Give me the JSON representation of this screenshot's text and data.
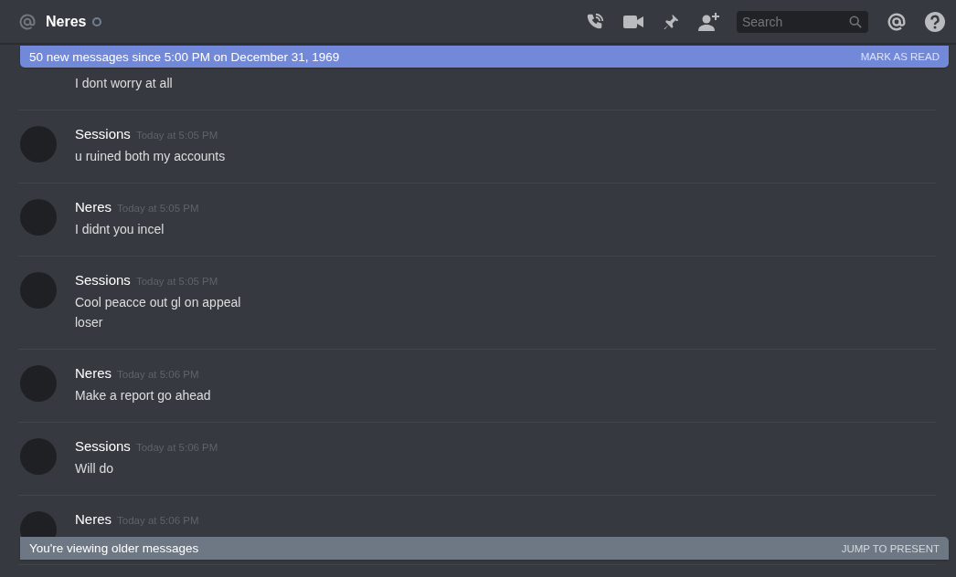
{
  "header": {
    "title": "Neres",
    "search_placeholder": "Search"
  },
  "new_messages_bar": {
    "text": "50 new messages since 5:00 PM on December 31, 1969",
    "action": "MARK AS READ"
  },
  "messages": [
    {
      "lines": [
        "I dont worry at all"
      ]
    },
    {
      "author": "Sessions",
      "time": "Today at 5:05 PM",
      "lines": [
        "u ruined both my accounts"
      ]
    },
    {
      "author": "Neres",
      "time": "Today at 5:05 PM",
      "lines": [
        "I didnt you incel"
      ]
    },
    {
      "author": "Sessions",
      "time": "Today at 5:05 PM",
      "lines": [
        "Cool peacce out gl on appeal",
        "loser"
      ]
    },
    {
      "author": "Neres",
      "time": "Today at 5:06 PM",
      "lines": [
        "Make a report go ahead"
      ]
    },
    {
      "author": "Sessions",
      "time": "Today at 5:06 PM",
      "lines": [
        "Will do"
      ]
    },
    {
      "author": "Neres",
      "time": "Today at 5:06 PM"
    }
  ],
  "older_messages_bar": {
    "text": "You're viewing older messages",
    "action": "JUMP TO PRESENT"
  }
}
